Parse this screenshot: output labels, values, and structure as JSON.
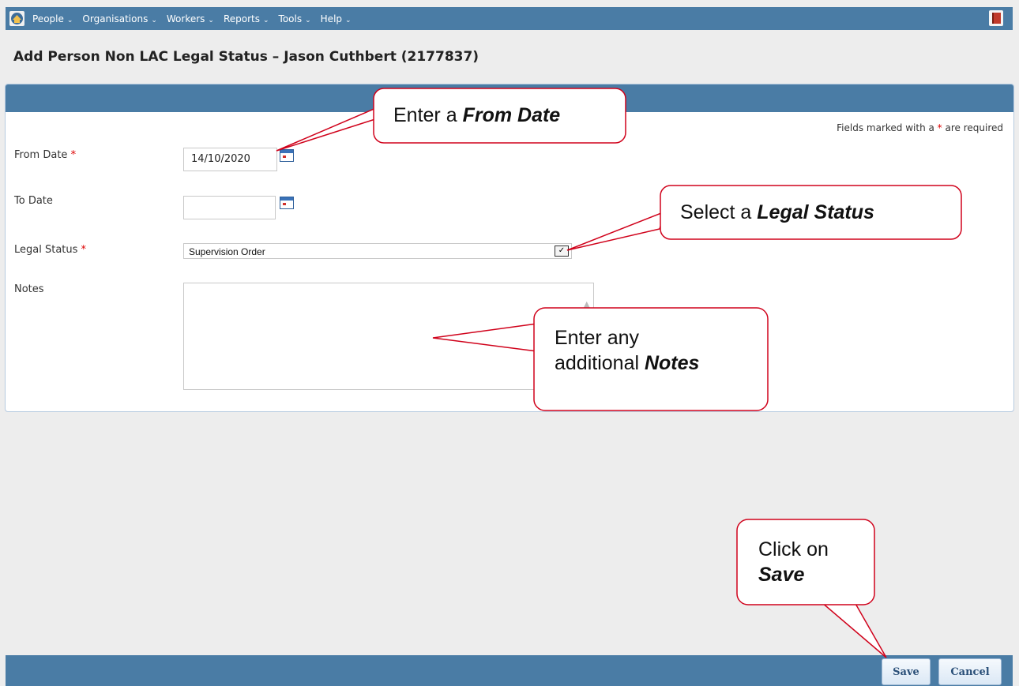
{
  "nav": {
    "items": [
      "People",
      "Organisations",
      "Workers",
      "Reports",
      "Tools",
      "Help"
    ],
    "chevron": "⌄"
  },
  "page": {
    "title": "Add Person Non LAC Legal Status – Jason Cuthbert (2177837)"
  },
  "form": {
    "required_note_prefix": "Fields marked with a ",
    "required_note_star": "*",
    "required_note_suffix": " are required",
    "from_date_label": "From Date",
    "from_date_value": "14/10/2020",
    "to_date_label": "To Date",
    "to_date_value": "",
    "legal_status_label": "Legal Status",
    "legal_status_value": "Supervision Order",
    "notes_label": "Notes",
    "notes_value": "",
    "required_star": "*"
  },
  "buttons": {
    "save": "Save",
    "cancel": "Cancel"
  },
  "callouts": {
    "from_date_prefix": "Enter a ",
    "from_date_emph": "From Date",
    "legal_status_prefix": "Select a ",
    "legal_status_emph": "Legal Status",
    "notes_line1": "Enter any",
    "notes_prefix": "additional ",
    "notes_emph": "Notes",
    "save_line1": "Click on",
    "save_emph": "Save"
  },
  "colors": {
    "bar": "#4a7ca5",
    "callout_border": "#d0021b",
    "required": "#dd0000"
  }
}
